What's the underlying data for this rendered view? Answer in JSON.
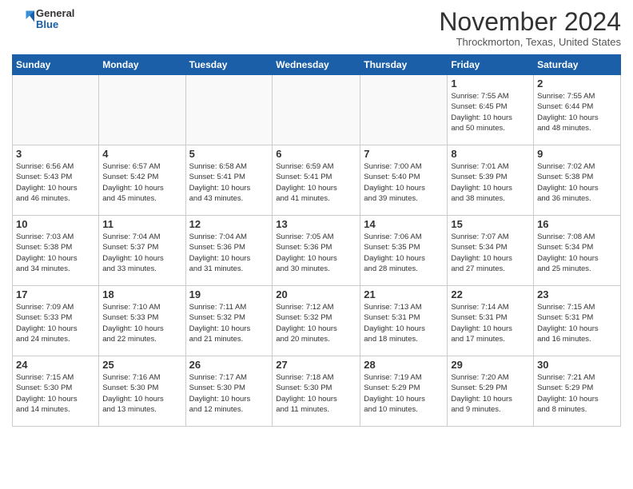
{
  "header": {
    "logo_general": "General",
    "logo_blue": "Blue",
    "month": "November 2024",
    "location": "Throckmorton, Texas, United States"
  },
  "days_of_week": [
    "Sunday",
    "Monday",
    "Tuesday",
    "Wednesday",
    "Thursday",
    "Friday",
    "Saturday"
  ],
  "weeks": [
    [
      {
        "day": "",
        "info": ""
      },
      {
        "day": "",
        "info": ""
      },
      {
        "day": "",
        "info": ""
      },
      {
        "day": "",
        "info": ""
      },
      {
        "day": "",
        "info": ""
      },
      {
        "day": "1",
        "info": "Sunrise: 7:55 AM\nSunset: 6:45 PM\nDaylight: 10 hours\nand 50 minutes."
      },
      {
        "day": "2",
        "info": "Sunrise: 7:55 AM\nSunset: 6:44 PM\nDaylight: 10 hours\nand 48 minutes."
      }
    ],
    [
      {
        "day": "3",
        "info": "Sunrise: 6:56 AM\nSunset: 5:43 PM\nDaylight: 10 hours\nand 46 minutes."
      },
      {
        "day": "4",
        "info": "Sunrise: 6:57 AM\nSunset: 5:42 PM\nDaylight: 10 hours\nand 45 minutes."
      },
      {
        "day": "5",
        "info": "Sunrise: 6:58 AM\nSunset: 5:41 PM\nDaylight: 10 hours\nand 43 minutes."
      },
      {
        "day": "6",
        "info": "Sunrise: 6:59 AM\nSunset: 5:41 PM\nDaylight: 10 hours\nand 41 minutes."
      },
      {
        "day": "7",
        "info": "Sunrise: 7:00 AM\nSunset: 5:40 PM\nDaylight: 10 hours\nand 39 minutes."
      },
      {
        "day": "8",
        "info": "Sunrise: 7:01 AM\nSunset: 5:39 PM\nDaylight: 10 hours\nand 38 minutes."
      },
      {
        "day": "9",
        "info": "Sunrise: 7:02 AM\nSunset: 5:38 PM\nDaylight: 10 hours\nand 36 minutes."
      }
    ],
    [
      {
        "day": "10",
        "info": "Sunrise: 7:03 AM\nSunset: 5:38 PM\nDaylight: 10 hours\nand 34 minutes."
      },
      {
        "day": "11",
        "info": "Sunrise: 7:04 AM\nSunset: 5:37 PM\nDaylight: 10 hours\nand 33 minutes."
      },
      {
        "day": "12",
        "info": "Sunrise: 7:04 AM\nSunset: 5:36 PM\nDaylight: 10 hours\nand 31 minutes."
      },
      {
        "day": "13",
        "info": "Sunrise: 7:05 AM\nSunset: 5:36 PM\nDaylight: 10 hours\nand 30 minutes."
      },
      {
        "day": "14",
        "info": "Sunrise: 7:06 AM\nSunset: 5:35 PM\nDaylight: 10 hours\nand 28 minutes."
      },
      {
        "day": "15",
        "info": "Sunrise: 7:07 AM\nSunset: 5:34 PM\nDaylight: 10 hours\nand 27 minutes."
      },
      {
        "day": "16",
        "info": "Sunrise: 7:08 AM\nSunset: 5:34 PM\nDaylight: 10 hours\nand 25 minutes."
      }
    ],
    [
      {
        "day": "17",
        "info": "Sunrise: 7:09 AM\nSunset: 5:33 PM\nDaylight: 10 hours\nand 24 minutes."
      },
      {
        "day": "18",
        "info": "Sunrise: 7:10 AM\nSunset: 5:33 PM\nDaylight: 10 hours\nand 22 minutes."
      },
      {
        "day": "19",
        "info": "Sunrise: 7:11 AM\nSunset: 5:32 PM\nDaylight: 10 hours\nand 21 minutes."
      },
      {
        "day": "20",
        "info": "Sunrise: 7:12 AM\nSunset: 5:32 PM\nDaylight: 10 hours\nand 20 minutes."
      },
      {
        "day": "21",
        "info": "Sunrise: 7:13 AM\nSunset: 5:31 PM\nDaylight: 10 hours\nand 18 minutes."
      },
      {
        "day": "22",
        "info": "Sunrise: 7:14 AM\nSunset: 5:31 PM\nDaylight: 10 hours\nand 17 minutes."
      },
      {
        "day": "23",
        "info": "Sunrise: 7:15 AM\nSunset: 5:31 PM\nDaylight: 10 hours\nand 16 minutes."
      }
    ],
    [
      {
        "day": "24",
        "info": "Sunrise: 7:15 AM\nSunset: 5:30 PM\nDaylight: 10 hours\nand 14 minutes."
      },
      {
        "day": "25",
        "info": "Sunrise: 7:16 AM\nSunset: 5:30 PM\nDaylight: 10 hours\nand 13 minutes."
      },
      {
        "day": "26",
        "info": "Sunrise: 7:17 AM\nSunset: 5:30 PM\nDaylight: 10 hours\nand 12 minutes."
      },
      {
        "day": "27",
        "info": "Sunrise: 7:18 AM\nSunset: 5:30 PM\nDaylight: 10 hours\nand 11 minutes."
      },
      {
        "day": "28",
        "info": "Sunrise: 7:19 AM\nSunset: 5:29 PM\nDaylight: 10 hours\nand 10 minutes."
      },
      {
        "day": "29",
        "info": "Sunrise: 7:20 AM\nSunset: 5:29 PM\nDaylight: 10 hours\nand 9 minutes."
      },
      {
        "day": "30",
        "info": "Sunrise: 7:21 AM\nSunset: 5:29 PM\nDaylight: 10 hours\nand 8 minutes."
      }
    ]
  ]
}
